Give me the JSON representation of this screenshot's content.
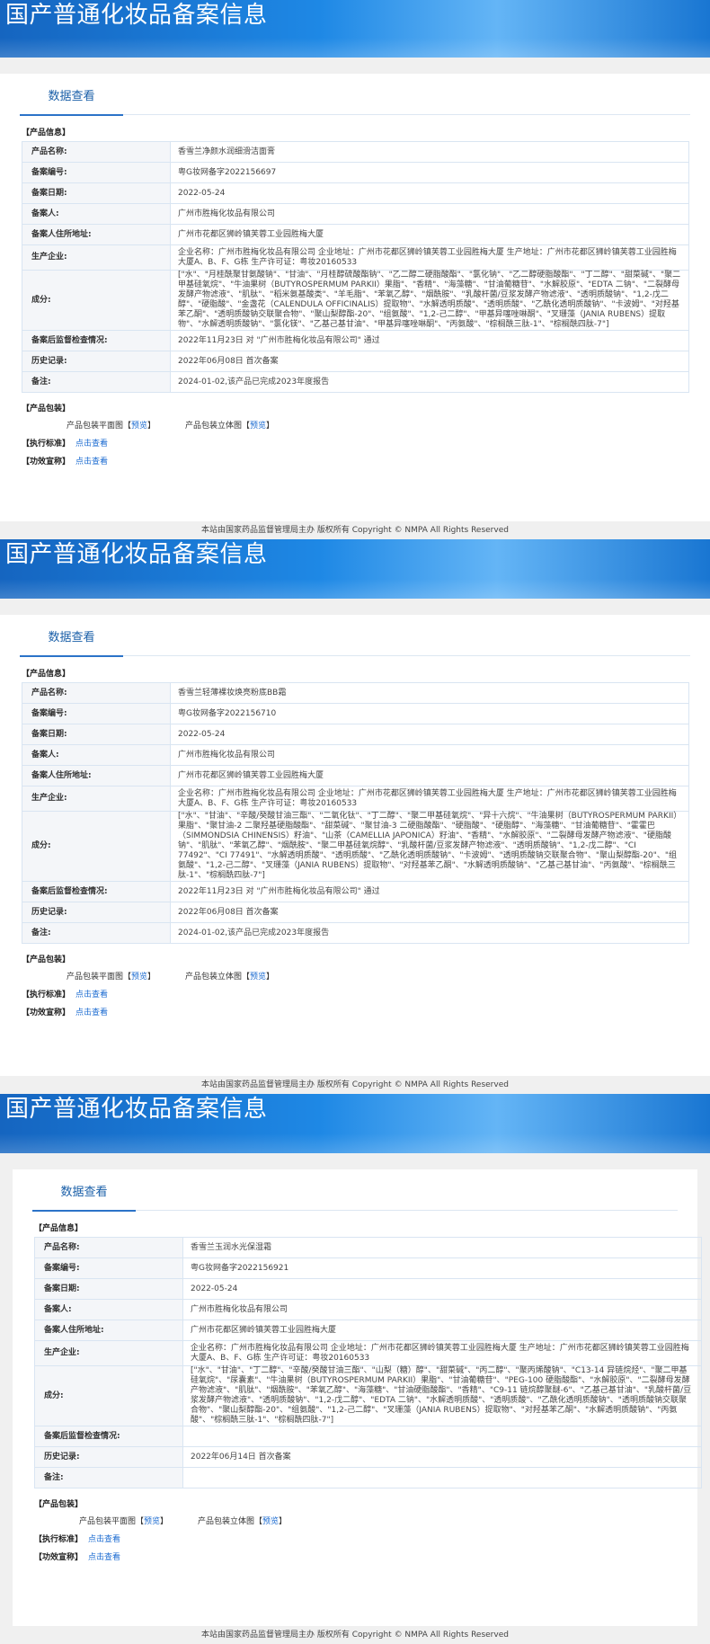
{
  "records": [
    {
      "banner_title": "国产普通化妆品备案信息",
      "tab_label": "数据查看",
      "product_info_label": "【产品信息】",
      "rows": [
        {
          "k": "产品名称:",
          "v": "香雪兰净颜水润细滑洁面膏"
        },
        {
          "k": "备案编号:",
          "v": "粤G妆网备字2022156697"
        },
        {
          "k": "备案日期:",
          "v": "2022-05-24"
        },
        {
          "k": "备案人:",
          "v": "广州市胜梅化妆品有限公司"
        },
        {
          "k": "备案人住所地址:",
          "v": "广州市花都区狮岭镇芙蓉工业园胜梅大厦"
        },
        {
          "k": "生产企业:",
          "v": "企业名称：广州市胜梅化妆品有限公司 企业地址：广州市花都区狮岭镇芙蓉工业园胜梅大厦 生产地址：广州市花都区狮岭镇芙蓉工业园胜梅大厦A、B、F、G栋 生产许可证：粤妆20160533"
        },
        {
          "k": "成分:",
          "v": "[\"水\"、\"月桂酰聚甘氨酸钠\"、\"甘油\"、\"月桂醇硫酸酯钠\"、\"乙二醇二硬脂酸酯\"、\"氯化钠\"、\"乙二醇硬脂酸酯\"、\"丁二醇\"、\"甜菜碱\"、\"聚二甲基硅氧烷\"、\"牛油果树（BUTYROSPERMUM PARKII）果脂\"、\"香精\"、\"海藻糖\"、\"甘油葡糖苷\"、\"水解胶原\"、\"EDTA 二钠\"、\"二裂酵母发酵产物滤液\"、\"肌肽\"、\"稻米氨基酸类\"、\"羊毛脂\"、\"苯氧乙醇\"、\"烟酰胺\"、\"乳酸杆菌/豆浆发酵产物滤液\"、\"透明质酸钠\"、\"1,2-戊二醇\"、\"硬脂酸\"、\"金盏花（CALENDULA OFFICINALIS）提取物\"、\"水解透明质酸\"、\"透明质酸\"、\"乙酰化透明质酸钠\"、\"卡波姆\"、\"对羟基苯乙酮\"、\"透明质酸钠交联聚合物\"、\"聚山梨醇酯-20\"、\"组氨酸\"、\"1,2-己二醇\"、\"甲基异噻唑啉酮\"、\"叉珊藻（JANIA RUBENS）提取物\"、\"水解透明质酸钠\"、\"氯化镁\"、\"乙基己基甘油\"、\"甲基异噻唑啉酮\"、\"丙氨酸\"、\"棕榈酰三肽-1\"、\"棕榈酰四肽-7\"]"
        },
        {
          "k": "备案后监督检查情况:",
          "v": "2022年11月23日 对 \"广州市胜梅化妆品有限公司\" 通过"
        },
        {
          "k": "历史记录:",
          "v": "2022年06月08日 首次备案"
        },
        {
          "k": "备注:",
          "v": "2024-01-02,该产品已完成2023年度报告"
        }
      ],
      "package_label": "【产品包装】",
      "pkg_flat": "产品包装平面图",
      "pkg_3d": "产品包装立体图",
      "preview_link": "预览",
      "standard_label": "【执行标准】",
      "efficacy_label": "【功效宣称】",
      "click_view": "点击查看",
      "footer": "本站由国家药品监督管理局主办 版权所有 Copyright © NMPA All Rights Reserved"
    },
    {
      "banner_title": "国产普通化妆品备案信息",
      "tab_label": "数据查看",
      "product_info_label": "【产品信息】",
      "rows": [
        {
          "k": "产品名称:",
          "v": "香雪兰轻薄裸妆焕亮粉底BB霜"
        },
        {
          "k": "备案编号:",
          "v": "粤G妆网备字2022156710"
        },
        {
          "k": "备案日期:",
          "v": "2022-05-24"
        },
        {
          "k": "备案人:",
          "v": "广州市胜梅化妆品有限公司"
        },
        {
          "k": "备案人住所地址:",
          "v": "广州市花都区狮岭镇芙蓉工业园胜梅大厦"
        },
        {
          "k": "生产企业:",
          "v": "企业名称：广州市胜梅化妆品有限公司 企业地址：广州市花都区狮岭镇芙蓉工业园胜梅大厦 生产地址：广州市花都区狮岭镇芙蓉工业园胜梅大厦A、B、F、G栋 生产许可证：粤妆20160533"
        },
        {
          "k": "成分:",
          "v": "[\"水\"、\"甘油\"、\"辛酸/癸酸甘油三酯\"、\"二氧化钛\"、\"丁二醇\"、\"聚二甲基硅氧烷\"、\"异十六烷\"、\"牛油果树（BUTYROSPERMUM PARKII）果脂\"、\"聚甘油-2 二聚羟基硬脂酸酯\"、\"甜菜碱\"、\"聚甘油-3 二硬脂酸酯\"、\"硬脂酸\"、\"硬脂醇\"、\"海藻糖\"、\"甘油葡糖苷\"、\"霍霍巴（SIMMONDSIA CHINENSIS）籽油\"、\"山茶（CAMELLIA JAPONICA）籽油\"、\"香精\"、\"水解胶原\"、\"二裂酵母发酵产物滤液\"、\"硬脂酸钠\"、\"肌肽\"、\"苯氧乙醇\"、\"烟酰胺\"、\"聚二甲基硅氧烷醇\"、\"乳酸杆菌/豆浆发酵产物滤液\"、\"透明质酸钠\"、\"1,2-戊二醇\"、\"CI 77492\"、\"CI 77491\"、\"水解透明质酸\"、\"透明质酸\"、\"乙酰化透明质酸钠\"、\"卡波姆\"、\"透明质酸钠交联聚合物\"、\"聚山梨醇酯-20\"、\"组氨酸\"、\"1,2-己二醇\"、\"叉珊藻（JANIA RUBENS）提取物\"、\"对羟基苯乙酮\"、\"水解透明质酸钠\"、\"乙基己基甘油\"、\"丙氨酸\"、\"棕榈酰三肽-1\"、\"棕榈酰四肽-7\"]"
        },
        {
          "k": "备案后监督检查情况:",
          "v": "2022年11月23日 对 \"广州市胜梅化妆品有限公司\" 通过"
        },
        {
          "k": "历史记录:",
          "v": "2022年06月08日 首次备案"
        },
        {
          "k": "备注:",
          "v": "2024-01-02,该产品已完成2023年度报告"
        }
      ],
      "package_label": "【产品包装】",
      "pkg_flat": "产品包装平面图",
      "pkg_3d": "产品包装立体图",
      "preview_link": "预览",
      "standard_label": "【执行标准】",
      "efficacy_label": "【功效宣称】",
      "click_view": "点击查看",
      "footer": "本站由国家药品监督管理局主办 版权所有 Copyright © NMPA All Rights Reserved"
    },
    {
      "banner_title": "国产普通化妆品备案信息",
      "tab_label": "数据查看",
      "product_info_label": "【产品信息】",
      "rows": [
        {
          "k": "产品名称:",
          "v": "香雪兰玉润水光保湿霜"
        },
        {
          "k": "备案编号:",
          "v": "粤G妆网备字2022156921"
        },
        {
          "k": "备案日期:",
          "v": "2022-05-24"
        },
        {
          "k": "备案人:",
          "v": "广州市胜梅化妆品有限公司"
        },
        {
          "k": "备案人住所地址:",
          "v": "广州市花都区狮岭镇芙蓉工业园胜梅大厦"
        },
        {
          "k": "生产企业:",
          "v": "企业名称：广州市胜梅化妆品有限公司 企业地址：广州市花都区狮岭镇芙蓉工业园胜梅大厦 生产地址：广州市花都区狮岭镇芙蓉工业园胜梅大厦A、B、F、G栋 生产许可证：粤妆20160533"
        },
        {
          "k": "成分:",
          "v": "[\"水\"、\"甘油\"、\"丁二醇\"、\"辛酸/癸酸甘油三酯\"、\"山梨（糖）醇\"、\"甜菜碱\"、\"丙二醇\"、\"聚丙烯酸钠\"、\"C13-14 异链烷烃\"、\"聚二甲基硅氧烷\"、\"尿囊素\"、\"牛油果树（BUTYROSPERMUM PARKII）果脂\"、\"甘油葡糖苷\"、\"PEG-100 硬脂酸酯\"、\"水解胶原\"、\"二裂酵母发酵产物滤液\"、\"肌肽\"、\"烟酰胺\"、\"苯氧乙醇\"、\"海藻糖\"、\"甘油硬脂酸酯\"、\"香精\"、\"C9-11 链烷醇聚醚-6\"、\"乙基己基甘油\"、\"乳酸杆菌/豆浆发酵产物滤液\"、\"透明质酸钠\"、\"1,2-戊二醇\"、\"EDTA 二钠\"、\"水解透明质酸\"、\"透明质酸\"、\"乙酰化透明质酸钠\"、\"透明质酸钠交联聚合物\"、\"聚山梨醇酯-20\"、\"组氨酸\"、\"1,2-己二醇\"、\"叉珊藻（JANIA RUBENS）提取物\"、\"对羟基苯乙酮\"、\"水解透明质酸钠\"、\"丙氨酸\"、\"棕榈酰三肽-1\"、\"棕榈酰四肽-7\"]"
        },
        {
          "k": "备案后监督检查情况:",
          "v": ""
        },
        {
          "k": "历史记录:",
          "v": "2022年06月14日 首次备案"
        },
        {
          "k": "备注:",
          "v": ""
        }
      ],
      "package_label": "【产品包装】",
      "pkg_flat": "产品包装平面图",
      "pkg_3d": "产品包装立体图",
      "preview_link": "预览",
      "standard_label": "【执行标准】",
      "efficacy_label": "【功效宣称】",
      "click_view": "点击查看",
      "footer": "本站由国家药品监督管理局主办 版权所有 Copyright © NMPA All Rights Reserved"
    }
  ]
}
